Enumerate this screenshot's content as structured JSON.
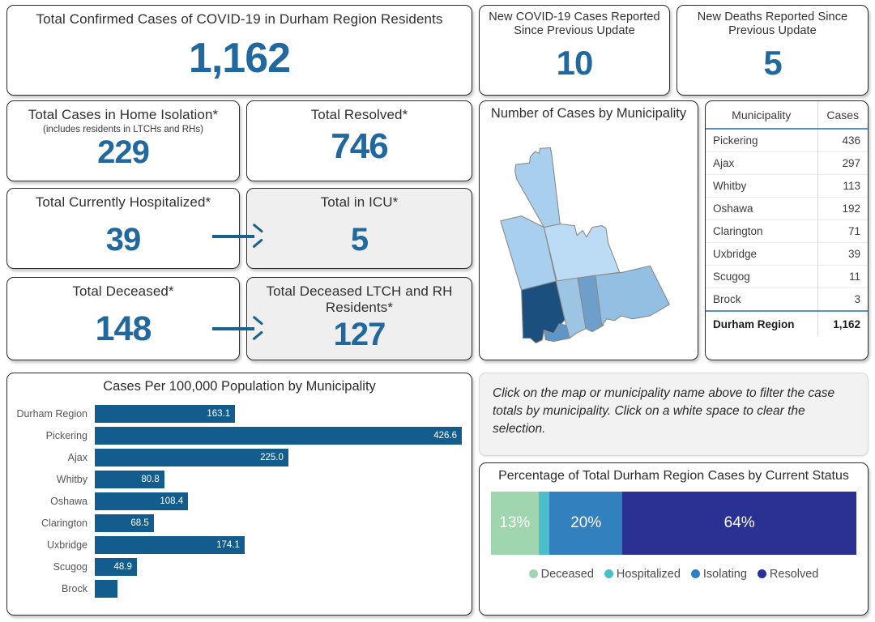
{
  "kpis": {
    "total_confirmed": {
      "title": "Total Confirmed Cases of COVID-19 in Durham Region Residents",
      "value": "1,162"
    },
    "new_cases": {
      "title": "New COVID-19 Cases Reported Since Previous Update",
      "value": "10"
    },
    "new_deaths": {
      "title": "New Deaths Reported Since Previous Update",
      "value": "5"
    },
    "home_isolation": {
      "title": "Total Cases in Home Isolation*",
      "subtitle": "(includes residents in LTCHs and RHs)",
      "value": "229"
    },
    "resolved": {
      "title": "Total Resolved*",
      "value": "746"
    },
    "hospitalized": {
      "title": "Total Currently Hospitalized*",
      "value": "39"
    },
    "icu": {
      "title": "Total in ICU*",
      "value": "5"
    },
    "deceased": {
      "title": "Total Deceased*",
      "value": "148"
    },
    "deceased_ltch": {
      "title": "Total Deceased LTCH and RH Residents*",
      "value": "127"
    }
  },
  "map": {
    "title": "Number of Cases by Municipality",
    "regions": [
      {
        "name": "Brock",
        "color": "#a8cfee"
      },
      {
        "name": "Uxbridge",
        "color": "#a8cfee"
      },
      {
        "name": "Scugog",
        "color": "#bcdbf4"
      },
      {
        "name": "Pickering",
        "color": "#1a4f7e"
      },
      {
        "name": "Ajax",
        "color": "#5d96c7"
      },
      {
        "name": "Whitby",
        "color": "#9cc5e4"
      },
      {
        "name": "Oshawa",
        "color": "#6e9fcb"
      },
      {
        "name": "Clarington",
        "color": "#93bfe2"
      }
    ]
  },
  "table": {
    "columns": [
      "Municipality",
      "Cases"
    ],
    "rows": [
      {
        "municipality": "Pickering",
        "cases": "436"
      },
      {
        "municipality": "Ajax",
        "cases": "297"
      },
      {
        "municipality": "Whitby",
        "cases": "113"
      },
      {
        "municipality": "Oshawa",
        "cases": "192"
      },
      {
        "municipality": "Clarington",
        "cases": "71"
      },
      {
        "municipality": "Uxbridge",
        "cases": "39"
      },
      {
        "municipality": "Scugog",
        "cases": "11"
      },
      {
        "municipality": "Brock",
        "cases": "3"
      }
    ],
    "total": {
      "municipality": "Durham Region",
      "cases": "1,162"
    }
  },
  "note": {
    "text": "Click on the map or municipality name above to filter the case totals by municipality. Click on a white space to clear the selection."
  },
  "chart_data": [
    {
      "type": "bar",
      "orientation": "horizontal",
      "title": "Cases Per 100,000 Population by Municipality",
      "xlabel": "",
      "ylabel": "",
      "categories": [
        "Durham Region",
        "Pickering",
        "Ajax",
        "Whitby",
        "Oshawa",
        "Clarington",
        "Uxbridge",
        "Scugog",
        "Brock"
      ],
      "values": [
        163.1,
        426.6,
        225.0,
        80.8,
        108.4,
        68.5,
        174.1,
        48.9,
        26.0
      ],
      "labels": [
        "163.1",
        "426.6",
        "225.0",
        "80.8",
        "108.4",
        "68.5",
        "174.1",
        "48.9",
        ""
      ],
      "xlim": [
        0,
        426.6
      ],
      "grid": false,
      "bar_color": "#125c8e"
    },
    {
      "type": "bar",
      "stacked": true,
      "orientation": "horizontal",
      "title": "Percentage of Total Durham Region Cases by Current Status",
      "legend_position": "bottom",
      "categories": [
        "Deceased",
        "Hospitalized",
        "Isolating",
        "Resolved"
      ],
      "values": [
        13,
        3,
        20,
        64
      ],
      "labels": [
        "13%",
        "",
        "20%",
        "64%"
      ],
      "colors": [
        "#9fd6b0",
        "#4bbecb",
        "#3380be",
        "#2b3192"
      ]
    }
  ],
  "theme": {
    "accent_blue": "#21689f",
    "bar_blue": "#125c8e",
    "arrow_blue": "#17628f",
    "card_border": "#2b2b2b",
    "gray_card_bg": "#efefef"
  }
}
